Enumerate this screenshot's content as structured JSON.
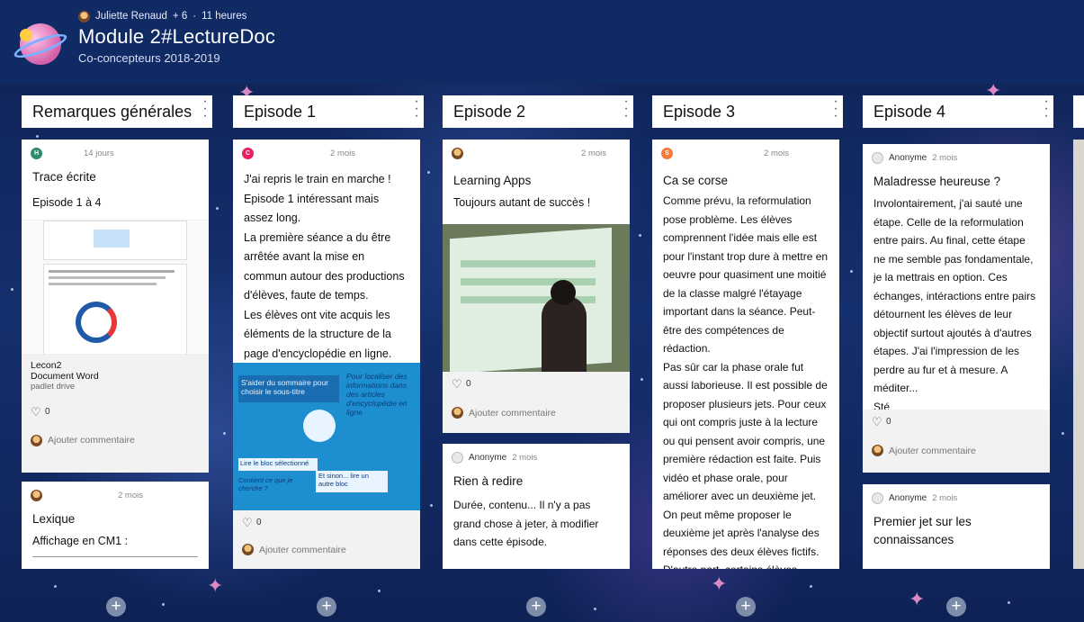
{
  "header": {
    "author": "Juliette Renaud",
    "contributors": "+ 6",
    "separator": "·",
    "time": "11 heures",
    "title": "Module 2#LectureDoc",
    "subtitle": "Co-concepteurs 2018-2019"
  },
  "columns": [
    {
      "title": "Remarques générales"
    },
    {
      "title": "Episode 1"
    },
    {
      "title": "Episode 2"
    },
    {
      "title": "Episode 3"
    },
    {
      "title": "Episode 4"
    }
  ],
  "cards": {
    "rg1": {
      "initial": "H",
      "time": "14 jours",
      "title": "Trace écrite",
      "subtitle": "Episode 1 à 4",
      "doc_title": "Lecon2",
      "doc_type": "Document Word",
      "doc_source": "padlet drive",
      "likes": "0",
      "comment_cta": "Ajouter commentaire"
    },
    "rg2": {
      "time": "2 mois",
      "title": "Lexique",
      "subtitle": "Affichage en CM1 :"
    },
    "e1": {
      "initial": "C",
      "time": "2 mois",
      "body": "J'ai repris le train en marche ! Episode 1 intéressant mais assez long.\nLa première séance a du être arrêtée avant la mise en commun autour des productions d'élèves, faute de temps.\nLes élèves ont vite acquis les éléments de la structure de la page d'encyclopédie en ligne.",
      "img_text_1": "S'aider du sommaire pour choisir le sous-titre",
      "img_text_2": "Lire le bloc sélectionné",
      "img_text_3": "Contient ce que je cherche ?",
      "img_text_4": "Et sinon... lire un autre bloc",
      "img_text_5": "Pour localiser des informations dans des articles d'encyclopédie en ligne",
      "likes": "0",
      "comment_cta": "Ajouter commentaire"
    },
    "e2a": {
      "time": "2 mois",
      "title": "Learning Apps",
      "body": "Toujours autant de succès !",
      "likes": "0",
      "comment_cta": "Ajouter commentaire"
    },
    "e2b": {
      "author": "Anonyme",
      "time": "2 mois",
      "title": "Rien à redire",
      "body": "Durée, contenu... Il n'y a pas grand chose à jeter, à modifier dans cette épisode."
    },
    "e3": {
      "initial": "S",
      "time": "2 mois",
      "title": "Ca se corse",
      "body": "Comme prévu, la reformulation pose problème. Les élèves comprennent l'idée mais elle est pour l'instant trop dure à mettre en oeuvre pour quasiment une moitié de la classe malgré l'étayage important dans la séance. Peut-être des compétences de rédaction.\nPas sûr car la phase orale fut aussi laborieuse. Il est possible de proposer plusieurs jets. Pour ceux qui ont compris juste à la lecture ou qui pensent avoir compris, une première rédaction est faite. Puis vidéo et phase orale, pour améliorer avec un deuxième jet. On peut même proposer le deuxième jet après l'analyse des réponses des deux élèves fictifs.\nD'autre part, certains élèves"
    },
    "e4a": {
      "author": "Anonyme",
      "time": "2 mois",
      "title": "Maladresse heureuse ?",
      "body": "Involontairement, j'ai sauté une étape. Celle de la reformulation entre pairs. Au final, cette étape ne me semble pas fondamentale, je la mettrais en option. Ces échanges, intéractions entre pairs détournent les élèves de leur objectif surtout ajoutés à d'autres étapes. J'ai l'impression de les perdre au fur et à mesure. A méditer...\nSté",
      "likes": "0",
      "comment_cta": "Ajouter commentaire"
    },
    "e4b": {
      "author": "Anonyme",
      "time": "2 mois",
      "title": "Premier jet sur les connaissances"
    }
  },
  "add_button": "+",
  "colors": {
    "accent_h": "#2e8b6e",
    "accent_c": "#e91e63",
    "accent_s": "#f57c3a",
    "header_bg": "#102a63"
  }
}
